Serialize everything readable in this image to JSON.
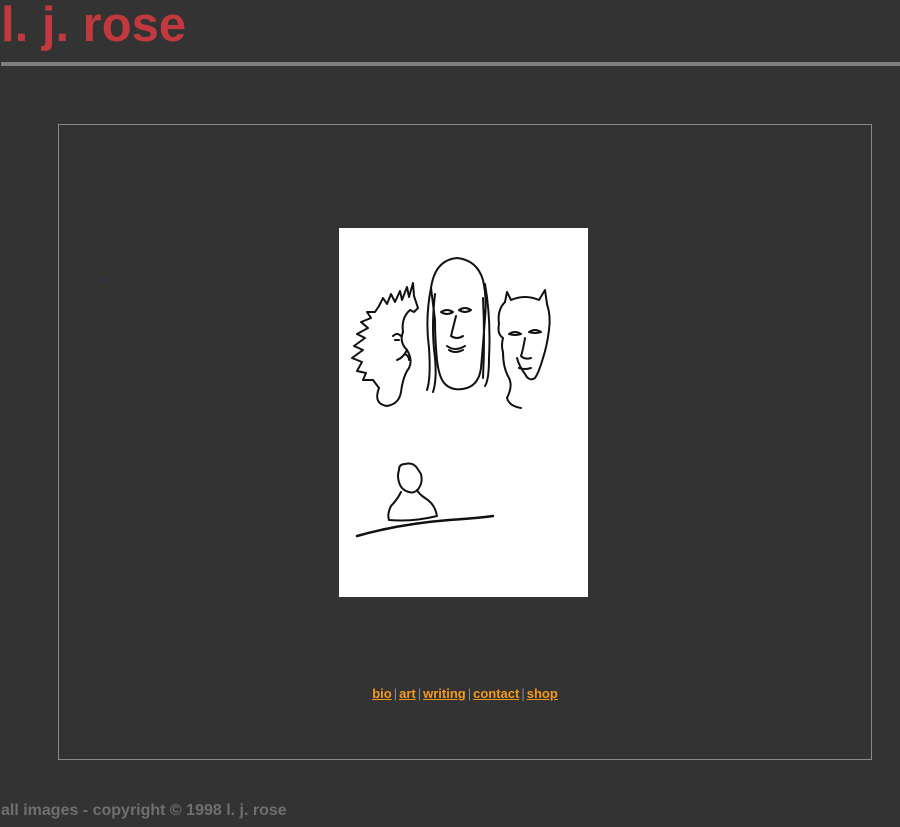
{
  "header": {
    "title": "l. j. rose"
  },
  "nav": {
    "links": [
      {
        "label": "bio"
      },
      {
        "label": "art"
      },
      {
        "label": "writing"
      },
      {
        "label": "contact"
      },
      {
        "label": "shop"
      }
    ],
    "separator": "|"
  },
  "footer": {
    "copyright": "all images - copyright © 1998 l. j. rose"
  },
  "colors": {
    "background": "#333333",
    "title": "#c1383f",
    "link": "#f39a1e",
    "rule": "#7f7f7f",
    "copyright": "#6f6f6f"
  }
}
